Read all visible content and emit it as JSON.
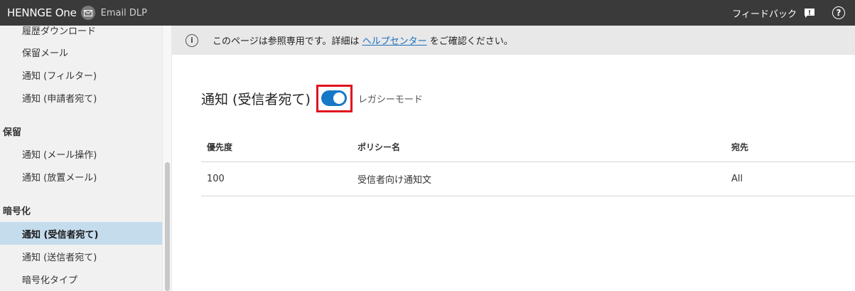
{
  "header": {
    "logo_text": "HENNGE",
    "logo_suffix": "One",
    "product": "Email DLP",
    "feedback_label": "フィードバック",
    "help_symbol": "?"
  },
  "sidebar": {
    "items_top": [
      {
        "label": "履歴ダウンロード"
      },
      {
        "label": "保留メール"
      },
      {
        "label": "通知 (フィルター)"
      },
      {
        "label": "通知 (申請者宛て)"
      }
    ],
    "section_hold": "保留",
    "items_hold": [
      {
        "label": "通知 (メール操作)"
      },
      {
        "label": "通知 (放置メール)"
      }
    ],
    "section_encrypt": "暗号化",
    "items_encrypt": [
      {
        "label": "通知 (受信者宛て)",
        "active": true
      },
      {
        "label": "通知 (送信者宛て)"
      },
      {
        "label": "暗号化タイプ"
      }
    ]
  },
  "notice": {
    "text_before": "このページは参照専用です。詳細は ",
    "link": "ヘルプセンター",
    "text_after": " をご確認ください。"
  },
  "page": {
    "title": "通知 (受信者宛て)",
    "toggle_on": true,
    "legacy_label": "レガシーモード"
  },
  "table": {
    "columns": [
      "優先度",
      "ポリシー名",
      "宛先"
    ],
    "rows": [
      [
        "100",
        "受信者向け通知文",
        "All"
      ]
    ]
  },
  "colors": {
    "topbar": "#3a3a3a",
    "active_item": "#c5dced",
    "toggle": "#1778c7",
    "highlight_border": "#e0141e",
    "link": "#1a6fc0"
  }
}
